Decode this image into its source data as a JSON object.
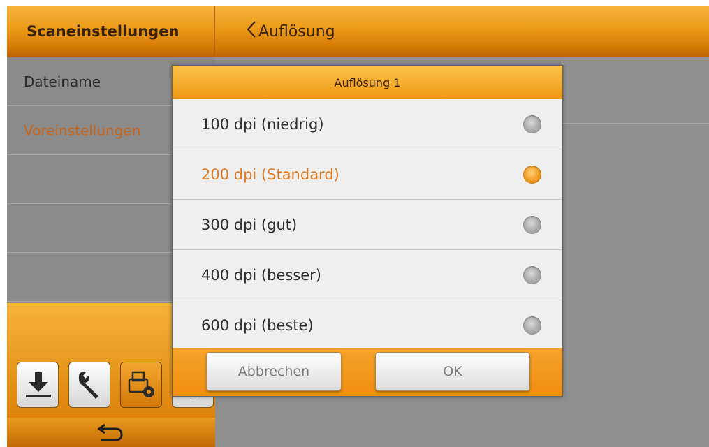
{
  "header": {
    "left_title": "Scaneinstellungen",
    "back_label": "Auflösung"
  },
  "sidebar": {
    "items": [
      {
        "label": "Dateiname"
      },
      {
        "label": "Voreinstellungen"
      }
    ]
  },
  "toolbar": {
    "icons": [
      "download-icon",
      "wrench-icon",
      "scanner-settings-icon",
      "gear-icon"
    ],
    "back_icon": "return-arrow-icon"
  },
  "dialog": {
    "title": "Auflösung 1",
    "options": [
      {
        "label": "100 dpi (niedrig)",
        "selected": false
      },
      {
        "label": "200 dpi (Standard)",
        "selected": true
      },
      {
        "label": "300 dpi (gut)",
        "selected": false
      },
      {
        "label": "400 dpi (besser)",
        "selected": false
      },
      {
        "label": "600 dpi (beste)",
        "selected": false
      }
    ],
    "cancel_label": "Abbrechen",
    "ok_label": "OK"
  },
  "colors": {
    "accent": "#f0980f",
    "selected_text": "#e07a1f",
    "header_text": "#3a2205"
  }
}
